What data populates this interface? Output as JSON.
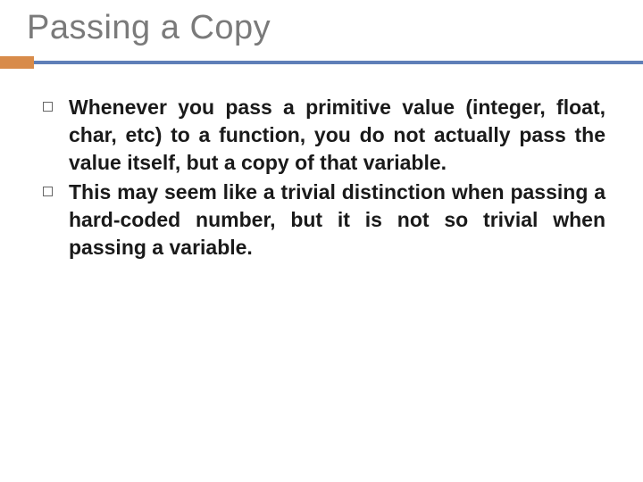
{
  "title": "Passing a Copy",
  "bullets": [
    "Whenever you pass a primitive value (integer, float, char, etc) to a function, you do not actually pass the value itself, but a copy of that variable.",
    "This may seem like a trivial distinction when passing a hard-coded number, but it is not so trivial when passing a variable."
  ]
}
